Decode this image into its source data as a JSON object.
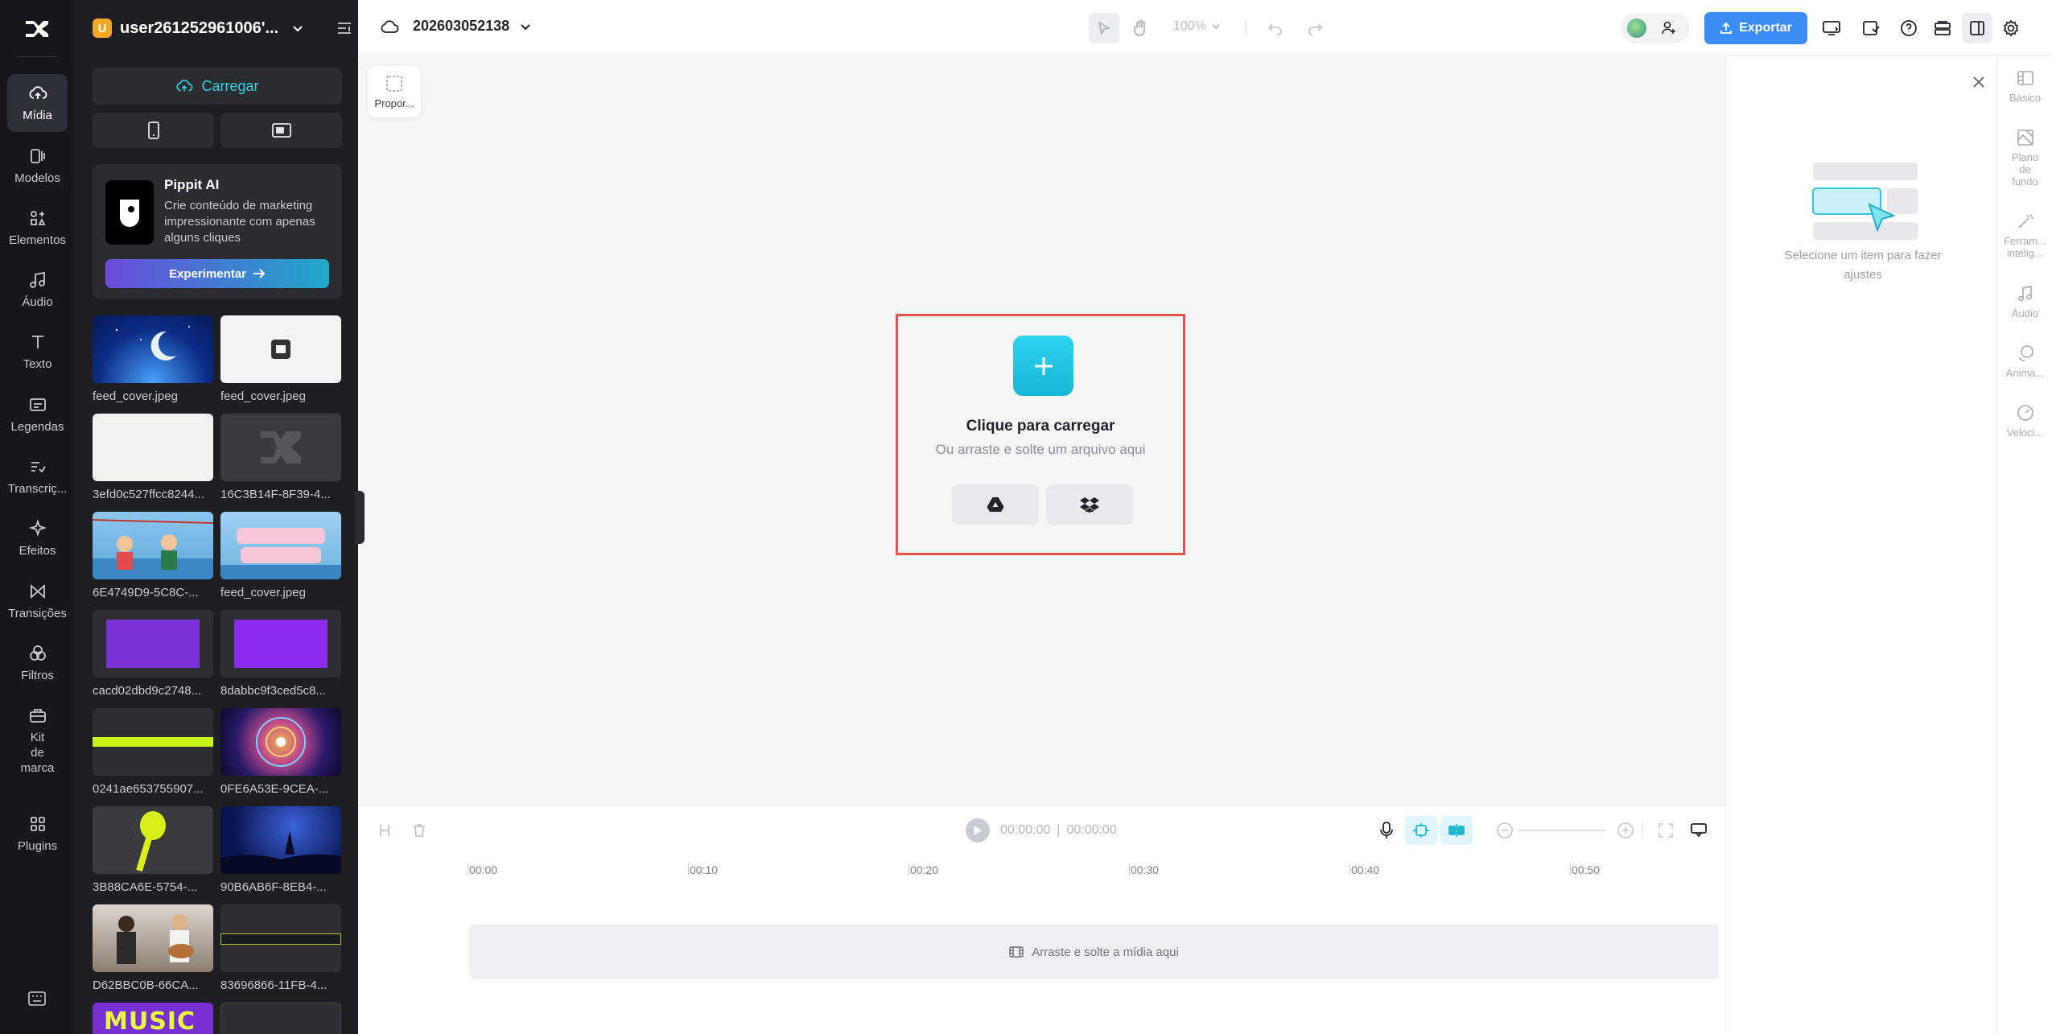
{
  "rail": {
    "items": [
      {
        "label": "Mídia",
        "icon": "cloud-upload-icon"
      },
      {
        "label": "Modelos",
        "icon": "templates-icon"
      },
      {
        "label": "Elementos",
        "icon": "elements-icon"
      },
      {
        "label": "Áudio",
        "icon": "music-note-icon"
      },
      {
        "label": "Texto",
        "icon": "text-icon"
      },
      {
        "label": "Legendas",
        "icon": "captions-icon"
      },
      {
        "label": "Transcriç...",
        "icon": "transcript-icon"
      },
      {
        "label": "Efeitos",
        "icon": "sparkle-icon"
      },
      {
        "label": "Transições",
        "icon": "transition-icon"
      },
      {
        "label": "Filtros",
        "icon": "filters-icon"
      },
      {
        "label": "Kit\nde\nmarca",
        "icon": "brand-kit-icon"
      },
      {
        "label": "Plugins",
        "icon": "plugins-icon"
      }
    ]
  },
  "panel": {
    "user_initial": "U",
    "username": "user261252961006'...",
    "upload_label": "Carregar",
    "promo": {
      "title": "Pippit AI",
      "description": "Crie conteúdo de marketing impressionante com apenas alguns cliques",
      "button": "Experimentar"
    },
    "media": [
      {
        "name": "feed_cover.jpeg"
      },
      {
        "name": "feed_cover.jpeg"
      },
      {
        "name": "3efd0c527ffcc8244..."
      },
      {
        "name": "16C3B14F-8F39-4..."
      },
      {
        "name": "6E4749D9-5C8C-..."
      },
      {
        "name": "feed_cover.jpeg"
      },
      {
        "name": "cacd02dbd9c2748..."
      },
      {
        "name": "8dabbc9f3ced5c8..."
      },
      {
        "name": "0241ae653755907..."
      },
      {
        "name": "0FE6A53E-9CEA-..."
      },
      {
        "name": "3B88CA6E-5754-..."
      },
      {
        "name": "90B6AB6F-8EB4-..."
      },
      {
        "name": "D62BBC0B-66CA..."
      },
      {
        "name": "83696866-11FB-4..."
      },
      {
        "name": ""
      },
      {
        "name": ""
      }
    ],
    "music_thumb_text": "MUSIC"
  },
  "topbar": {
    "project_name": "202603052138",
    "zoom": "100%",
    "export_label": "Exportar"
  },
  "canvas": {
    "proportion_label": "Propor...",
    "dropzone": {
      "title": "Clique para carregar",
      "subtitle": "Ou arraste e solte um arquivo aqui"
    }
  },
  "right_panel": {
    "hint": "Selecione um item para fazer ajustes",
    "tabs": [
      {
        "label": "Básico"
      },
      {
        "label": "Plano\nde\nfundo"
      },
      {
        "label": "Ferram...\nintelig..."
      },
      {
        "label": "Áudio"
      },
      {
        "label": "Anima..."
      },
      {
        "label": "Veloci..."
      }
    ]
  },
  "timeline": {
    "current_time": "00:00:00",
    "total_time": "00:00:00",
    "ticks": [
      "00:00",
      "00:10",
      "00:20",
      "00:30",
      "00:40",
      "00:50"
    ],
    "track_hint": "Arraste e solte a mídia aqui"
  },
  "colors": {
    "accent": "#33d1e0",
    "export": "#3b8cf5",
    "dropzone_border": "#e9524a",
    "rail_bg": "#16171b",
    "panel_bg": "#1e1f23"
  }
}
